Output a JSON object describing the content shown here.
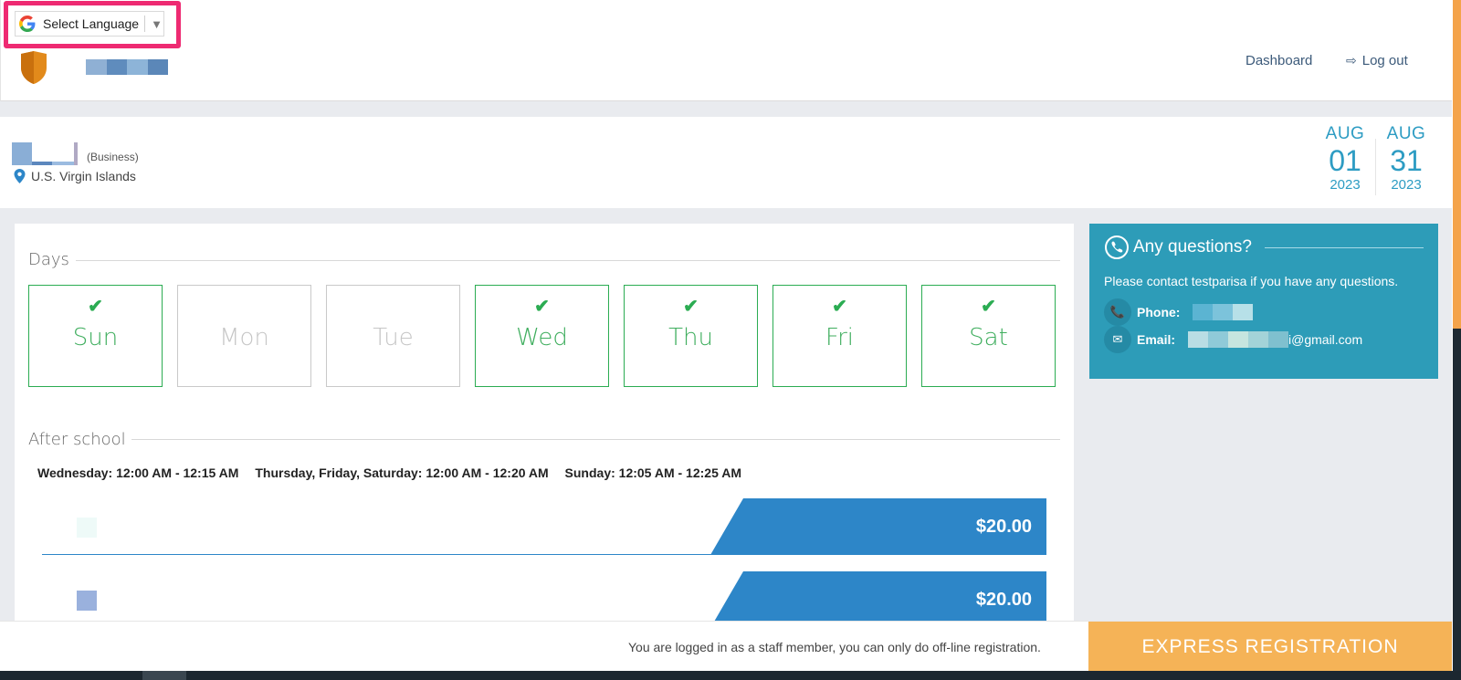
{
  "language": {
    "label": "Select Language",
    "caret": "▼"
  },
  "nav": {
    "dashboard": "Dashboard",
    "logout": "Log out"
  },
  "business": {
    "tag": "(Business)",
    "location": "U.S. Virgin Islands"
  },
  "dates": {
    "start": {
      "month": "AUG",
      "day": "01",
      "year": "2023"
    },
    "end": {
      "month": "AUG",
      "day": "31",
      "year": "2023"
    }
  },
  "days_section": {
    "title": "Days",
    "days": [
      {
        "label": "Sun",
        "selected": true
      },
      {
        "label": "Mon",
        "selected": false
      },
      {
        "label": "Tue",
        "selected": false
      },
      {
        "label": "Wed",
        "selected": true
      },
      {
        "label": "Thu",
        "selected": true
      },
      {
        "label": "Fri",
        "selected": true
      },
      {
        "label": "Sat",
        "selected": true
      }
    ],
    "check_glyph": "✔"
  },
  "program": {
    "title": "After school",
    "schedule": [
      "Wednesday: 12:00 AM - 12:15 AM",
      "Thursday, Friday, Saturday: 12:00 AM - 12:20 AM",
      "Sunday: 12:05 AM - 12:25 AM"
    ],
    "prices": [
      "$20.00",
      "$20.00"
    ]
  },
  "questions": {
    "title": "Any questions?",
    "text": "Please contact testparisa if you have any questions.",
    "phone_label": "Phone:",
    "email_label": "Email:",
    "email_suffix": "i@gmail.com"
  },
  "footer": {
    "note": "You are logged in as a staff member, you can only do off-line registration.",
    "express": "EXPRESS REGISTRATION"
  },
  "colors": {
    "accent_teal": "#2d9cb8",
    "price_blue": "#2d86c8",
    "selected_green": "#2bac52",
    "express_orange": "#f5b357",
    "highlight_pink": "#ee2a72"
  }
}
